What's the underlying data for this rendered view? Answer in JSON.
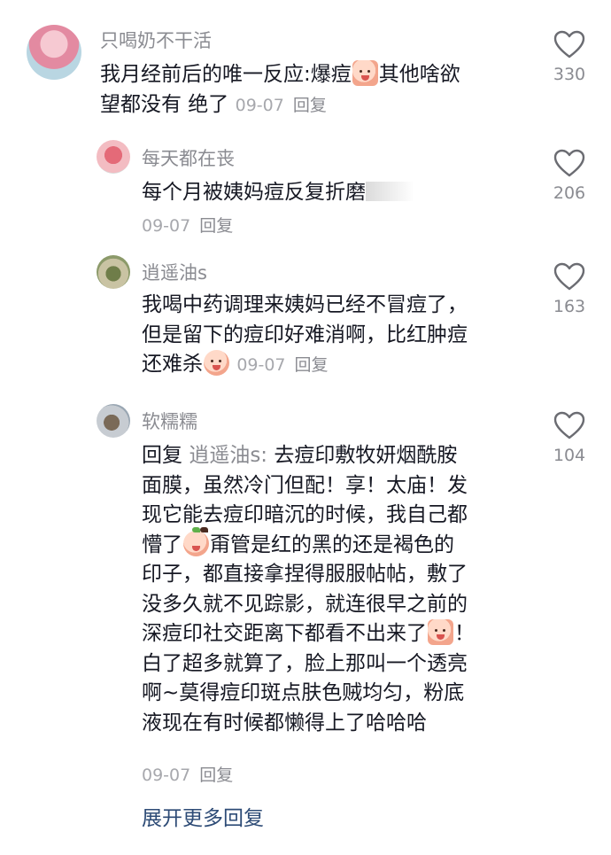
{
  "comments": [
    {
      "username": "只喝奶不干活",
      "text_a": "我月经前后的唯一反应:爆痘",
      "text_b": "其他啥欲",
      "text_c": "望都没有 绝了",
      "date": "09-07",
      "reply": "回复",
      "likes": "330"
    },
    {
      "username": "每天都在丧",
      "text": "每个月被姨妈痘反复折磨",
      "date": "09-07",
      "reply": "回复",
      "likes": "206"
    },
    {
      "username": "逍遥油s",
      "line1": "我喝中药调理来姨妈已经不冒痘了，",
      "line2": "但是留下的痘印好难消啊，比红肿痘",
      "line3": "还难杀",
      "date": "09-07",
      "reply": "回复",
      "likes": "163"
    },
    {
      "username": "软糯糯",
      "reply_prefix": "回复",
      "reply_target": "逍遥油s:",
      "line1_rest": "去痘印敷牧妍烟酰胺",
      "line2": "面膜，虽然冷门但配！享！太庙！发",
      "line3": "现它能去痘印暗沉的时候，我自己都",
      "line4a": "懵了",
      "line4b": "甭管是红的黑的还是褐色的",
      "line5": "印子，都直接拿捏得服服帖帖，敷了",
      "line6": "没多久就不见踪影，就连很早之前的",
      "line7a": "深痘印社交距离下都看不出来了",
      "line7b": "！",
      "line8": "白了超多就算了，脸上那叫一个透亮",
      "line9": "啊~莫得痘印斑点肤色贼均匀，粉底",
      "line10": "液现在有时候都懒得上了哈哈哈",
      "date": "09-07",
      "reply": "回复",
      "likes": "104"
    }
  ],
  "expand_label": "展开更多回复",
  "icons": {
    "like": "heart-outline-icon"
  },
  "colors": {
    "username": "#8a8b91",
    "text": "#161823",
    "meta": "#a7a8ad",
    "expand": "#2d4b76"
  }
}
